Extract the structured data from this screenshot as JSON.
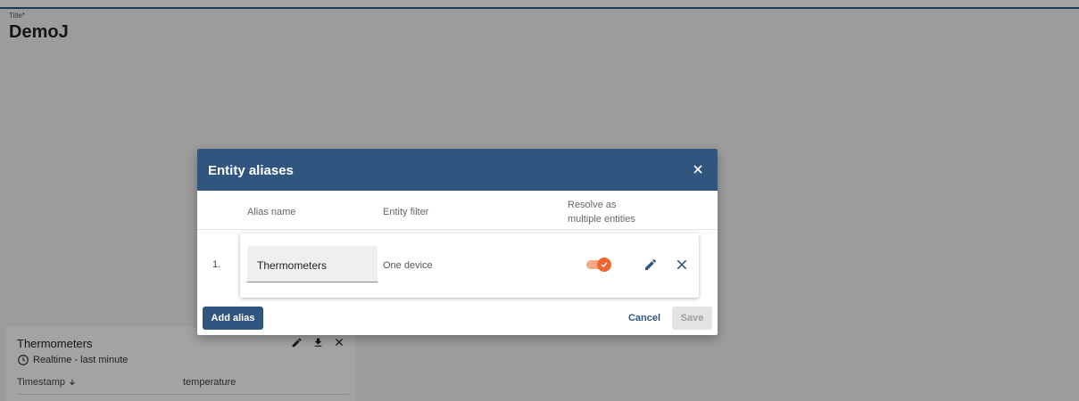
{
  "page": {
    "title_caption": "Title*",
    "title_value": "DemoJ"
  },
  "widget": {
    "title": "Thermometers",
    "timewindow": "Realtime - last minute",
    "columns": {
      "timestamp": "Timestamp",
      "temperature": "temperature"
    },
    "icons": [
      "pencil-icon",
      "download-icon",
      "close-icon",
      "clock-icon",
      "arrow-down-icon"
    ]
  },
  "dialog": {
    "title": "Entity aliases",
    "headers": {
      "alias_name": "Alias name",
      "entity_filter": "Entity filter",
      "resolve_line1": "Resolve as",
      "resolve_line2": "multiple entities"
    },
    "rows": [
      {
        "index": "1.",
        "alias": "Thermometers",
        "filter": "One device",
        "resolve_multiple": true
      }
    ],
    "buttons": {
      "add": "Add alias",
      "cancel": "Cancel",
      "save": "Save"
    }
  },
  "colors": {
    "primary": "#305680",
    "accent": "#ef6534",
    "accent_light": "#f5a887",
    "disabled_bg": "#e3e3e3",
    "disabled_text": "#9e9e9e"
  }
}
